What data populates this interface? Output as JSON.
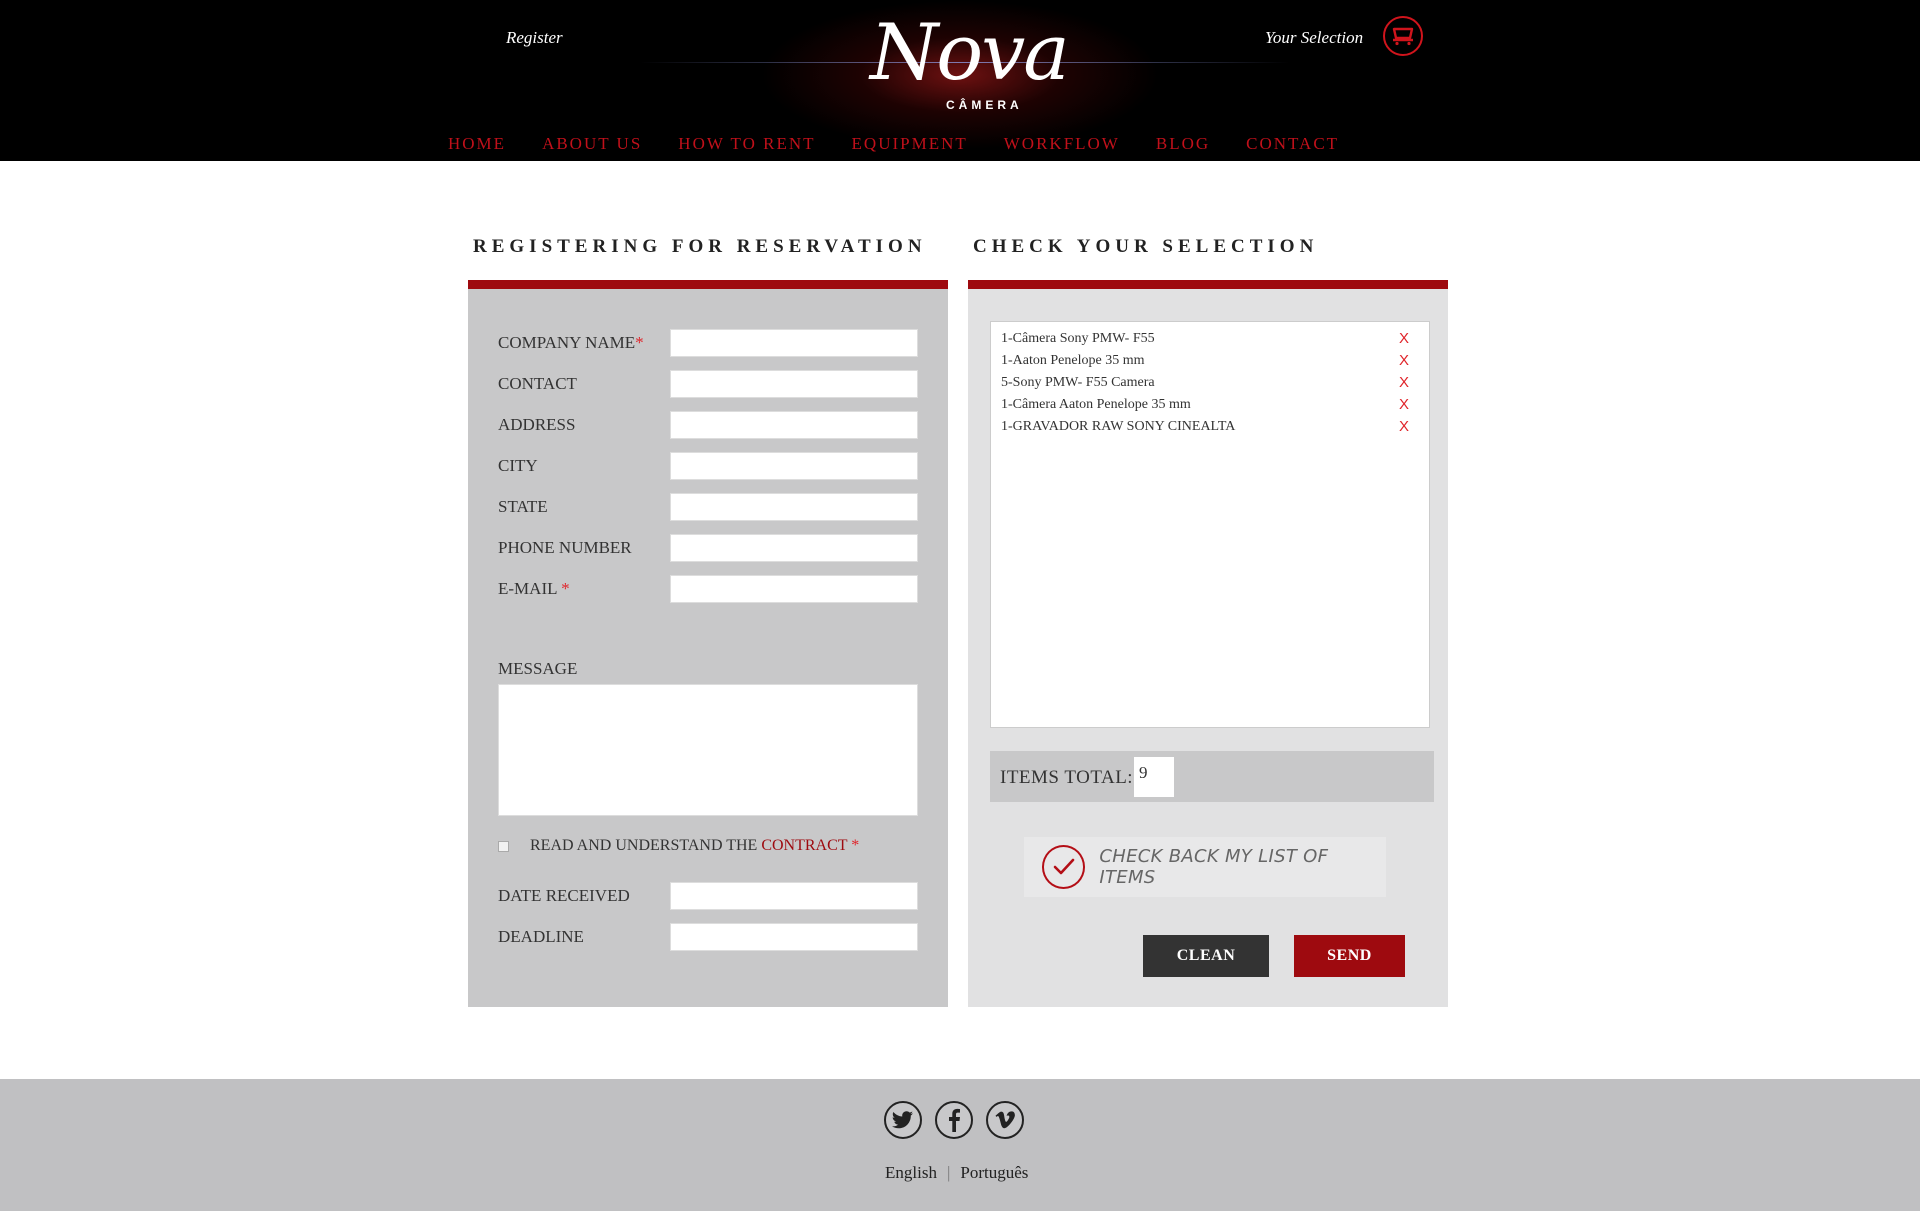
{
  "header": {
    "register_label": "Register",
    "logo_word": "Nova",
    "logo_sub": "CÂMERA",
    "your_selection_label": "Your Selection",
    "cart_icon": "cart-icon"
  },
  "nav": {
    "items": [
      {
        "label": "HOME"
      },
      {
        "label": "ABOUT US"
      },
      {
        "label": "HOW TO RENT"
      },
      {
        "label": "EQUIPMENT"
      },
      {
        "label": "WORKFLOW"
      },
      {
        "label": "BLOG"
      },
      {
        "label": "CONTACT"
      }
    ]
  },
  "form": {
    "title": "REGISTERING FOR RESERVATION",
    "fields": [
      {
        "label": "COMPANY NAME",
        "required_mark": "*",
        "value": ""
      },
      {
        "label": "CONTACT",
        "required_mark": "",
        "value": ""
      },
      {
        "label": "ADDRESS",
        "required_mark": "",
        "value": ""
      },
      {
        "label": "CITY",
        "required_mark": "",
        "value": ""
      },
      {
        "label": "STATE",
        "required_mark": "",
        "value": ""
      },
      {
        "label": "PHONE NUMBER",
        "required_mark": "",
        "value": ""
      },
      {
        "label": "E-MAIL ",
        "required_mark": "*",
        "value": ""
      }
    ],
    "message_label": "MESSAGE",
    "message_value": "",
    "agree_text": "READ AND UNDERSTAND THE ",
    "contract_link": "CONTRACT",
    "agree_required": " *",
    "agree_checked": false,
    "date_received_label": "DATE RECEIVED",
    "date_received_value": "",
    "deadline_label": "DEADLINE",
    "deadline_value": ""
  },
  "selection": {
    "title": "CHECK YOUR SELECTION",
    "items": [
      {
        "text": "1-Câmera Sony PMW- F55",
        "remove": "X"
      },
      {
        "text": "1-Aaton Penelope 35 mm",
        "remove": "X"
      },
      {
        "text": "5-Sony PMW- F55 Camera",
        "remove": "X"
      },
      {
        "text": "1-Câmera Aaton Penelope 35 mm",
        "remove": "X"
      },
      {
        "text": "1-GRAVADOR RAW SONY CINEALTA",
        "remove": "X"
      }
    ],
    "items_total_label": "ITEMS TOTAL:",
    "items_total_value": "9",
    "check_back_label": "CHECK BACK MY LIST OF ITEMS",
    "check_icon": "checkmark-icon",
    "clean_label": "CLEAN",
    "send_label": "SEND"
  },
  "footer": {
    "social": [
      {
        "icon": "twitter-icon"
      },
      {
        "icon": "facebook-icon"
      },
      {
        "icon": "vimeo-icon"
      }
    ],
    "languages": [
      "English",
      "Português"
    ],
    "separator": "|"
  },
  "colors": {
    "brand_red": "#9e0a0f",
    "nav_red": "#c0101a",
    "header_bg": "#000000",
    "panel_gray": "#c8c8c9",
    "footer_gray": "#c0c0c2"
  }
}
